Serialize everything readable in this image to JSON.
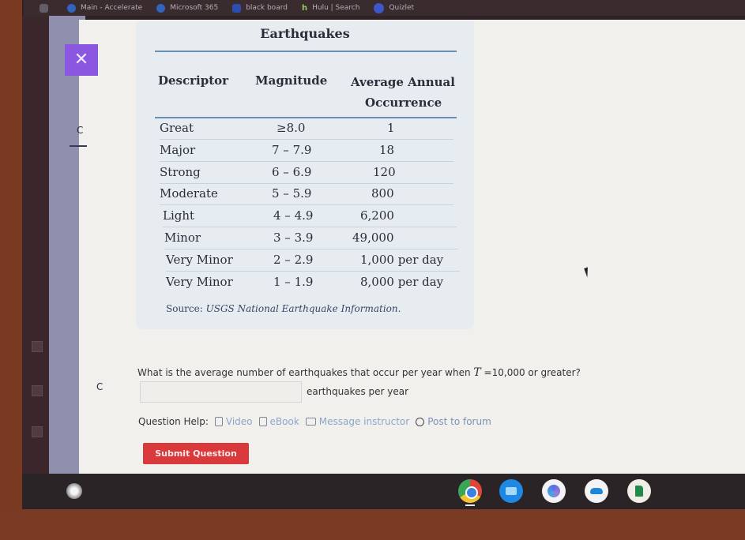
{
  "bookmarks": [
    {
      "label": "",
      "icon": "app-icon"
    },
    {
      "label": "Main - Accelerate",
      "icon": "blue-circle-icon"
    },
    {
      "label": "Microsoft 365",
      "icon": "microsoft-365-icon"
    },
    {
      "label": "black board",
      "icon": "blackboard-icon"
    },
    {
      "label": "Hulu | Search",
      "icon": "hulu-icon"
    },
    {
      "label": "Quizlet",
      "icon": "quizlet-icon"
    }
  ],
  "close_button": {
    "icon": "close-icon",
    "glyph": "✕"
  },
  "side_letters": {
    "top": "C",
    "bottom": "C"
  },
  "table": {
    "title": "Earthquakes",
    "headers": {
      "descriptor": "Descriptor",
      "magnitude": "Magnitude",
      "occurrence_line1": "Average Annual",
      "occurrence_line2": "Occurrence"
    },
    "rows": [
      {
        "descriptor": "Great",
        "magnitude": "≥8.0",
        "occurrence": "1"
      },
      {
        "descriptor": "Major",
        "magnitude": "7 – 7.9",
        "occurrence": "18"
      },
      {
        "descriptor": "Strong",
        "magnitude": "6 – 6.9",
        "occurrence": "120"
      },
      {
        "descriptor": "Moderate",
        "magnitude": "5 – 5.9",
        "occurrence": "800"
      },
      {
        "descriptor": "Light",
        "magnitude": "4 – 4.9",
        "occurrence": "6,200"
      },
      {
        "descriptor": "Minor",
        "magnitude": "3 – 3.9",
        "occurrence": "49,000"
      },
      {
        "descriptor": "Very Minor",
        "magnitude": "2 – 2.9",
        "occurrence": "1,000 per day"
      },
      {
        "descriptor": "Very Minor",
        "magnitude": "1 – 1.9",
        "occurrence": "8,000 per day"
      }
    ],
    "source_label": "Source:",
    "source_text": "USGS National Earthquake Information."
  },
  "question": {
    "text_before": "What is the average number of earthquakes that occur per year when ",
    "variable": "T",
    "text_after": " =10,000 or greater?",
    "answer_value": "",
    "answer_placeholder": "",
    "unit": "earthquakes per year"
  },
  "help": {
    "label": "Question Help:",
    "links": [
      {
        "label": "Video",
        "icon": "video-icon"
      },
      {
        "label": "eBook",
        "icon": "ebook-icon"
      },
      {
        "label": "Message instructor",
        "icon": "mail-icon"
      },
      {
        "label": "Post to forum",
        "icon": "forum-icon"
      }
    ]
  },
  "submit_label": "Submit Question",
  "shelf_apps": [
    "Chrome",
    "Files",
    "Microsoft 365",
    "OneDrive",
    "Sheets"
  ],
  "colors": {
    "close_button": "#8b57e0",
    "submit_button": "#d9393b",
    "table_rule": "#6b8fb2",
    "help_link": "#8aa7c9"
  }
}
